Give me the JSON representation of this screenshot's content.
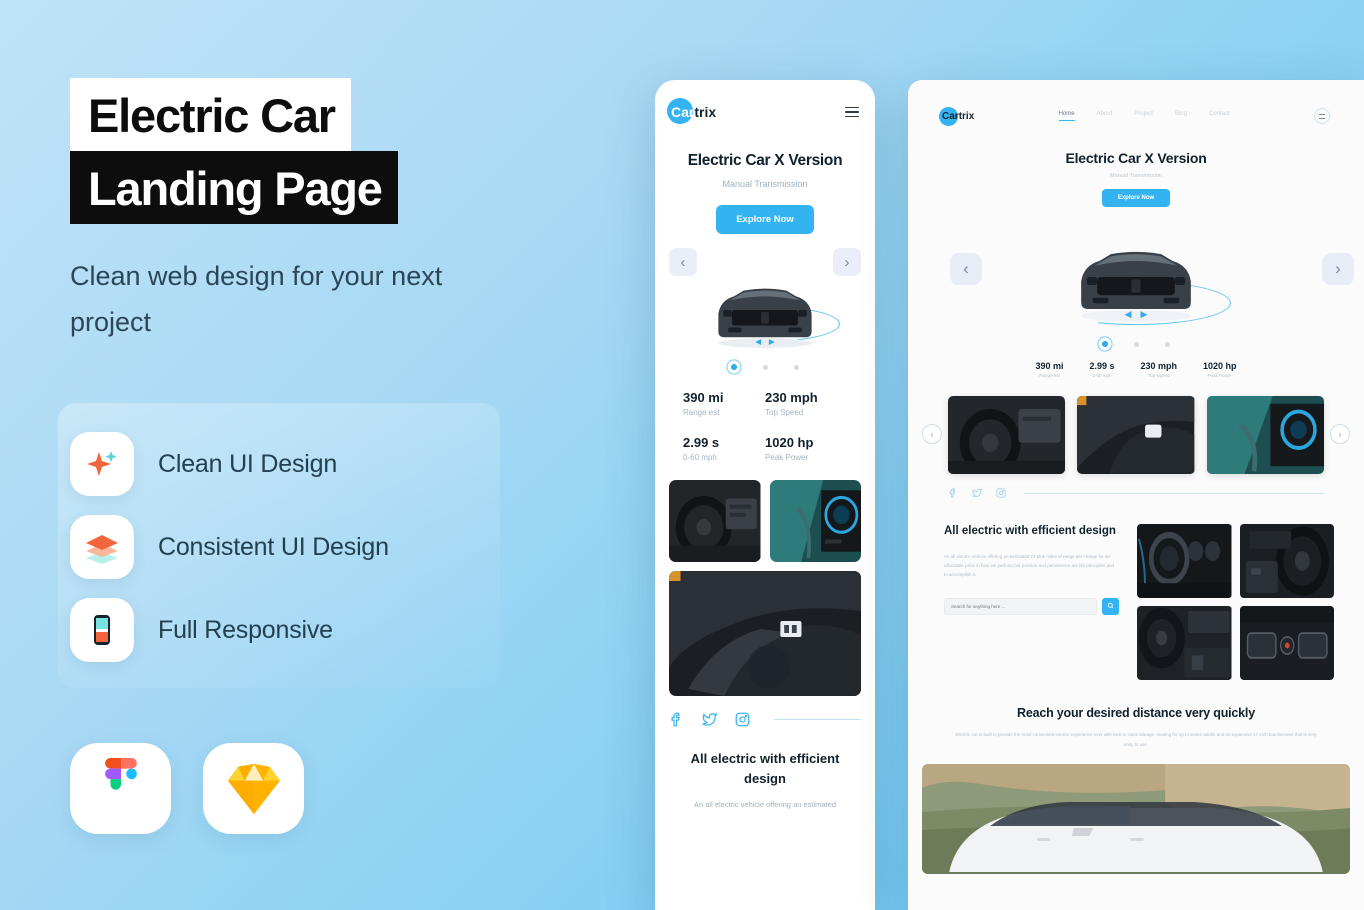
{
  "promo": {
    "title_line_1": "Electric Car",
    "title_line_2": "Landing Page",
    "subtitle": "Clean web design for your next project",
    "features": [
      {
        "label": "Clean UI Design",
        "icon": "sparkle-icon"
      },
      {
        "label": "Consistent UI Design",
        "icon": "layers-icon"
      },
      {
        "label": "Full Responsive",
        "icon": "mobile-phone-icon"
      }
    ],
    "tools": [
      {
        "name": "figma-logo"
      },
      {
        "name": "sketch-logo"
      }
    ]
  },
  "colors": {
    "accent_blue": "#33b3f1",
    "accent_orange": "#f2663c",
    "accent_teal": "#5ed4d4",
    "bg_top": "#bfe3f7",
    "bg_bottom": "#62c6f3",
    "ink": "#11212c"
  },
  "mobile": {
    "brand_prefix": "Car",
    "brand_suffix": "trix",
    "menu_icon": "hamburger-menu-icon",
    "hero_title": "Electric Car X Version",
    "hero_subtitle": "Manual Transmission",
    "cta_label": "Explore Now",
    "prev_label": "‹",
    "next_label": "›",
    "specs": [
      {
        "value": "390 mi",
        "label": "Range est"
      },
      {
        "value": "230 mph",
        "label": "Top Speed"
      },
      {
        "value": "2.99 s",
        "label": "0-60 mph"
      },
      {
        "value": "1020 hp",
        "label": "Peak Power"
      }
    ],
    "social": [
      "facebook-icon",
      "twitter-icon",
      "instagram-icon"
    ],
    "section_title": "All electric with efficient design",
    "section_body": "An all electric vehicle offering an estimated"
  },
  "desktop": {
    "brand_prefix": "Car",
    "brand_suffix": "trix",
    "nav": [
      {
        "label": "Home",
        "active": true
      },
      {
        "label": "About",
        "active": false
      },
      {
        "label": "Project",
        "active": false
      },
      {
        "label": "Blog",
        "active": false
      },
      {
        "label": "Contact",
        "active": false
      }
    ],
    "menu_icon": "hamburger-menu-icon",
    "hero_title": "Electric Car X Version",
    "hero_subtitle": "Manual Transmission",
    "cta_label": "Explore Now",
    "prev_label": "‹",
    "next_label": "›",
    "gallery_prev": "‹",
    "gallery_next": "›",
    "specs": [
      {
        "value": "390 mi",
        "label": "Range est"
      },
      {
        "value": "2.99 s",
        "label": "0-60 mph"
      },
      {
        "value": "230 mph",
        "label": "Top Speed"
      },
      {
        "value": "1020 hp",
        "label": "Peak Power"
      }
    ],
    "social": [
      "facebook-icon",
      "twitter-icon",
      "instagram-icon"
    ],
    "section_title": "All electric with efficient design",
    "section_body": "An all electric vehicle offering an estimated 23 plus miles of range per charge for an affordable price in how we perform but passion and persistence are life principles and to accomplish it.",
    "search_placeholder": "Search for anything here ...",
    "search_button_icon": "search-icon",
    "band_title": "Reach your desired distance very quickly",
    "band_body": "Electric car is built to provide the most convenient interior experience ever with best in class storage, seating for up to seven adults and an expansive 17 inch touchscreen that is very easy to use."
  }
}
